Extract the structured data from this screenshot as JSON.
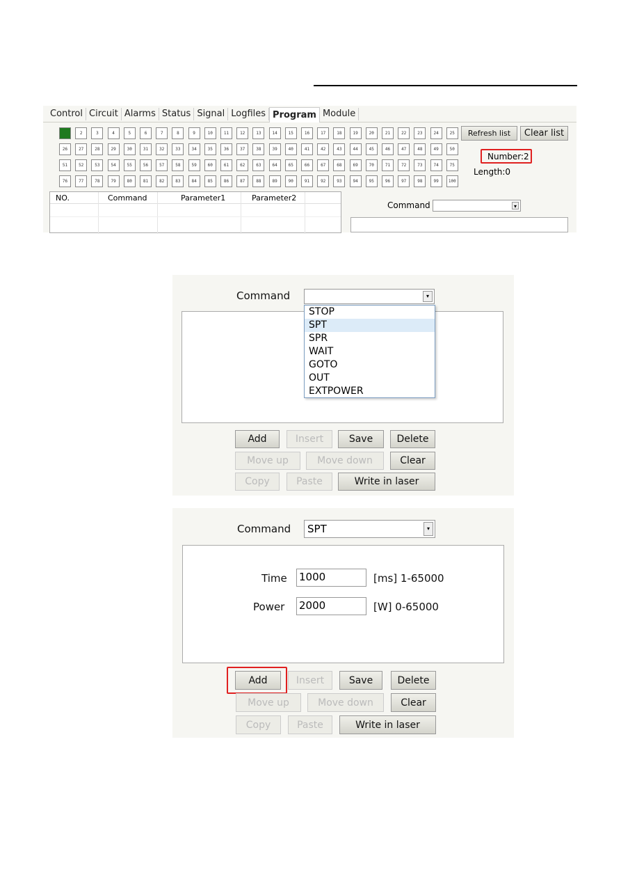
{
  "shot1": {
    "tabs": [
      "Control",
      "Circuit",
      "Alarms",
      "Status",
      "Signal",
      "Logfiles",
      "Program",
      "Module"
    ],
    "active_tab": "Program",
    "cells": [
      1,
      2,
      3,
      4,
      5,
      6,
      7,
      8,
      9,
      10,
      11,
      12,
      13,
      14,
      15,
      16,
      17,
      18,
      19,
      20,
      21,
      22,
      23,
      24,
      25,
      26,
      27,
      28,
      29,
      30,
      31,
      32,
      33,
      34,
      35,
      36,
      37,
      38,
      39,
      40,
      41,
      42,
      43,
      44,
      45,
      46,
      47,
      48,
      49,
      50,
      51,
      52,
      53,
      54,
      55,
      56,
      57,
      58,
      59,
      60,
      61,
      62,
      63,
      64,
      65,
      66,
      67,
      68,
      69,
      70,
      71,
      72,
      73,
      74,
      75,
      76,
      77,
      78,
      79,
      80,
      81,
      82,
      83,
      84,
      85,
      86,
      87,
      88,
      89,
      90,
      91,
      92,
      93,
      94,
      95,
      96,
      97,
      98,
      99,
      100
    ],
    "selected_cell": 1,
    "refresh_list": "Refresh list",
    "clear_list": "Clear list",
    "number": "Number:2",
    "length": "Length:0",
    "columns": [
      "NO.",
      "Command",
      "Parameter1",
      "Parameter2"
    ],
    "command_label": "Command",
    "command_value": ""
  },
  "shot2": {
    "command_label": "Command",
    "command_value": "",
    "options": [
      "STOP",
      "SPT",
      "SPR",
      "WAIT",
      "GOTO",
      "OUT",
      "EXTPOWER"
    ],
    "highlighted_option": "SPT",
    "buttons": {
      "add": "Add",
      "insert": "Insert",
      "save": "Save",
      "delete": "Delete",
      "move_up": "Move up",
      "move_down": "Move down",
      "clear": "Clear",
      "copy": "Copy",
      "paste": "Paste",
      "write": "Write in laser"
    }
  },
  "shot3": {
    "command_label": "Command",
    "command_value": "SPT",
    "time_label": "Time",
    "time_value": "1000",
    "time_range": "[ms] 1-65000",
    "power_label": "Power",
    "power_value": "2000",
    "power_range": "[W] 0-65000",
    "buttons": {
      "add": "Add",
      "insert": "Insert",
      "save": "Save",
      "delete": "Delete",
      "move_up": "Move up",
      "move_down": "Move down",
      "clear": "Clear",
      "copy": "Copy",
      "paste": "Paste",
      "write": "Write in laser"
    }
  },
  "colors": {
    "selected_cell": "#1f7a1f",
    "highlight_box": "#e02020",
    "dropdown_highlight": "#dcebf8"
  }
}
